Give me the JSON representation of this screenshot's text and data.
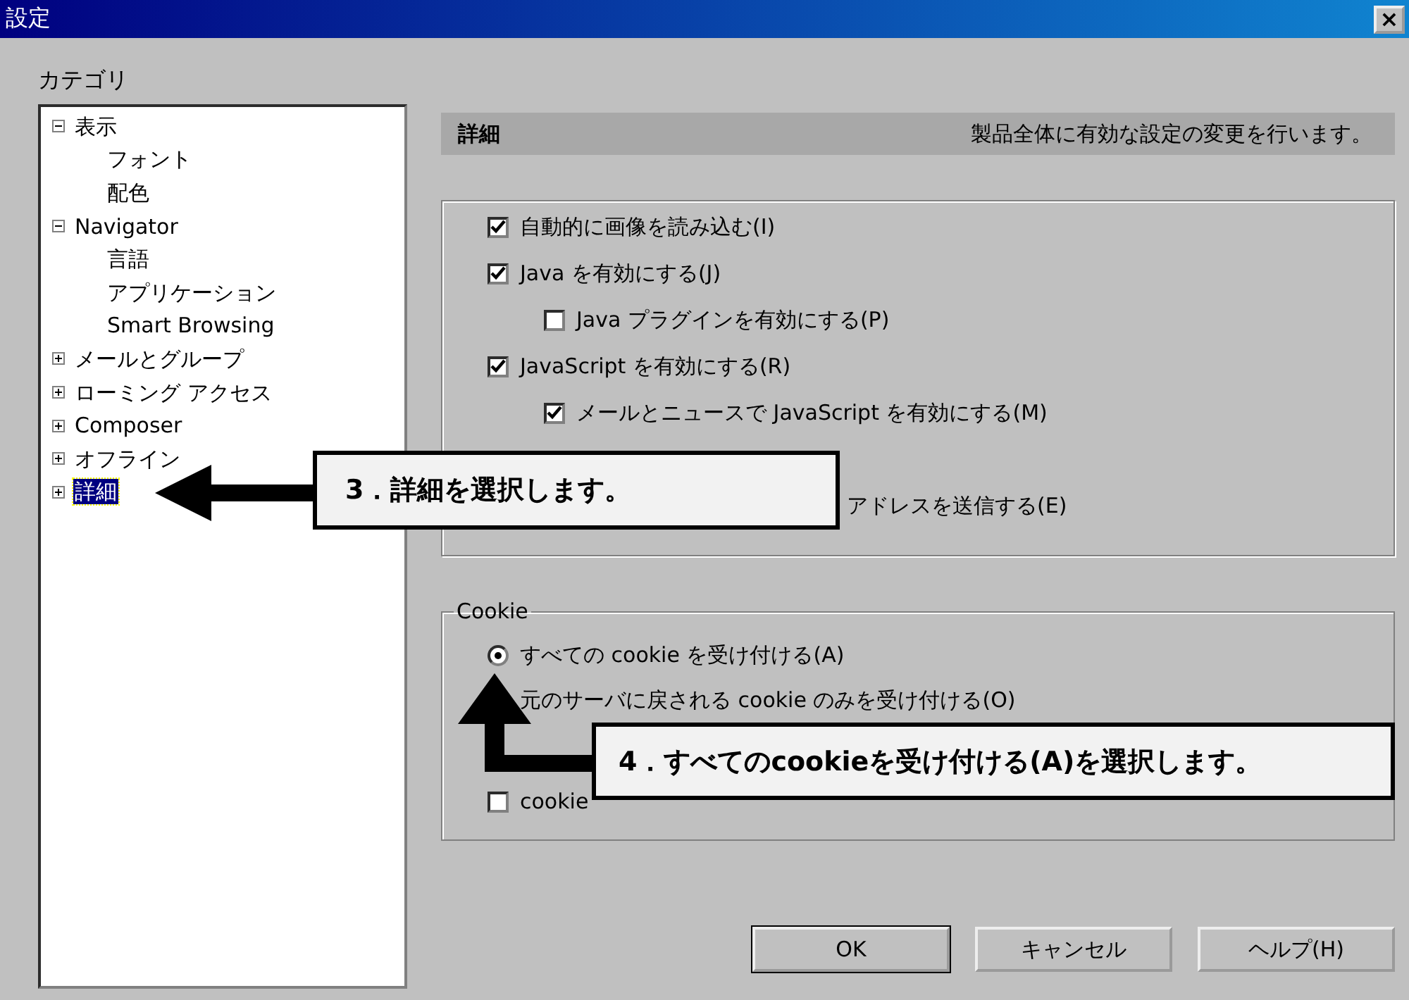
{
  "window": {
    "title": "設定",
    "close": "×"
  },
  "category_label": "カテゴリ",
  "tree": [
    {
      "label": "表示",
      "expanded": true,
      "selected": false,
      "children": [
        {
          "label": "フォント",
          "selected": false
        },
        {
          "label": "配色",
          "selected": false
        }
      ]
    },
    {
      "label": "Navigator",
      "expanded": true,
      "selected": false,
      "children": [
        {
          "label": "言語",
          "selected": false
        },
        {
          "label": "アプリケーション",
          "selected": false
        },
        {
          "label": "Smart Browsing",
          "selected": false
        }
      ]
    },
    {
      "label": "メールとグループ",
      "expanded": false,
      "selected": false
    },
    {
      "label": "ローミング アクセス",
      "expanded": false,
      "selected": false
    },
    {
      "label": "Composer",
      "expanded": false,
      "selected": false
    },
    {
      "label": "オフライン",
      "expanded": false,
      "selected": false
    },
    {
      "label": "詳細",
      "expanded": false,
      "selected": true
    }
  ],
  "header": {
    "title": "詳細",
    "description": "製品全体に有効な設定の変更を行います。"
  },
  "options": [
    {
      "label": "自動的に画像を読み込む(I)",
      "checked": true
    },
    {
      "label": "Java を有効にする(J)",
      "checked": true,
      "children": [
        {
          "label": "Java プラグインを有効にする(P)",
          "checked": false
        }
      ]
    },
    {
      "label": "JavaScript を有効にする(R)",
      "checked": true,
      "children": [
        {
          "label": "メールとニュースで JavaScript を有効にする(M)",
          "checked": true
        }
      ]
    },
    {
      "label": "アドレスを送信する(E)"
    }
  ],
  "cookie": {
    "legend": "Cookie",
    "items": [
      {
        "kind": "radio",
        "label": "すべての cookie を受け付ける(A)",
        "selected": true
      },
      {
        "kind": "radio",
        "label": "元のサーバに戻される cookie のみを受け付ける(O)"
      },
      {
        "kind": "checkbox",
        "label": "cookie",
        "checked": false
      }
    ]
  },
  "buttons": [
    "OK",
    "キャンセル",
    "ヘルプ(H)"
  ],
  "callouts": [
    {
      "kind": "left",
      "text": "3．詳細を選択します。"
    },
    {
      "kind": "up",
      "text": "4．すべてのcookieを受け付ける(A)を選択します。"
    }
  ]
}
